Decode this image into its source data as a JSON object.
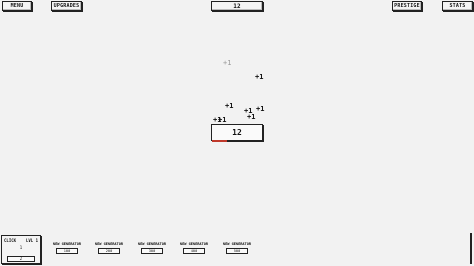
{
  "top_bar": {
    "menu_label": "MENU",
    "upgrades_label": "UPGRADES",
    "counter": "12",
    "prestige_label": "PRESTIGE",
    "stats_label": "STATS"
  },
  "floating_gains": [
    {
      "text": "+1",
      "faded": true
    },
    {
      "text": "+1",
      "faded": false
    },
    {
      "text": "+1",
      "faded": false
    },
    {
      "text": "+1",
      "faded": false
    },
    {
      "text": "+1",
      "faded": false
    },
    {
      "text": "+1",
      "faded": false
    },
    {
      "text": "+1",
      "faded": false
    },
    {
      "text": "+1",
      "faded": false
    }
  ],
  "click_area": {
    "value": "12",
    "progress_fraction": 0.3
  },
  "click_panel": {
    "title": "CLICK",
    "level": "LVL 1",
    "value": "1",
    "cost": "2"
  },
  "generators": [
    {
      "label": "NEW GENERATOR",
      "cost": "100"
    },
    {
      "label": "NEW GENERATOR",
      "cost": "200"
    },
    {
      "label": "NEW GENERATOR",
      "cost": "300"
    },
    {
      "label": "NEW GENERATOR",
      "cost": "400"
    },
    {
      "label": "NEW GENERATOR",
      "cost": "500"
    }
  ],
  "colors": {
    "progress": "#c0392b",
    "border": "#222222",
    "background": "#f2f2f2"
  }
}
